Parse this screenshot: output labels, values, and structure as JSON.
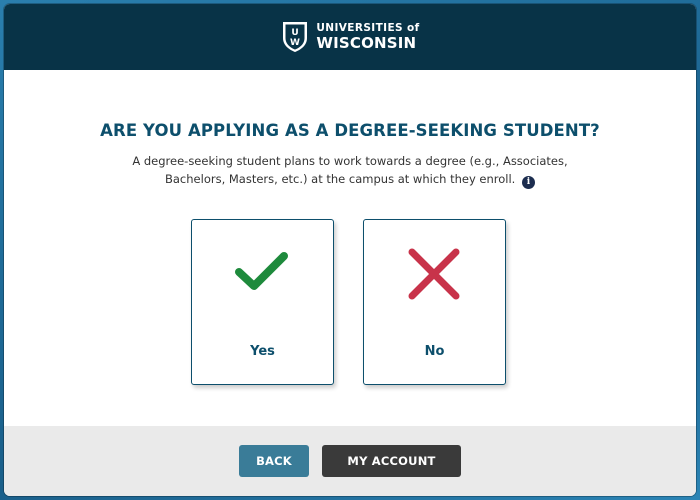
{
  "header": {
    "logo_line1": "UNIVERSITIES of",
    "logo_line2": "WISCONSIN",
    "logo_icon": "uw-crest-icon"
  },
  "question": {
    "title": "ARE YOU APPLYING AS A DEGREE-SEEKING STUDENT?",
    "description": "A degree-seeking student plans to work towards a degree (e.g., Associates, Bachelors, Masters, etc.) at the campus at which they enroll.",
    "info_icon": "info-icon",
    "info_glyph": "i"
  },
  "options": {
    "yes": {
      "label": "Yes",
      "icon": "checkmark-icon",
      "color": "#1e8a3c"
    },
    "no": {
      "label": "No",
      "icon": "x-mark-icon",
      "color": "#c8334a"
    }
  },
  "footer": {
    "back_label": "BACK",
    "account_label": "MY ACCOUNT"
  },
  "colors": {
    "header_bg": "#083347",
    "accent": "#0d4f6c",
    "back_button": "#3a7c98",
    "account_button": "#3a3a3a"
  }
}
